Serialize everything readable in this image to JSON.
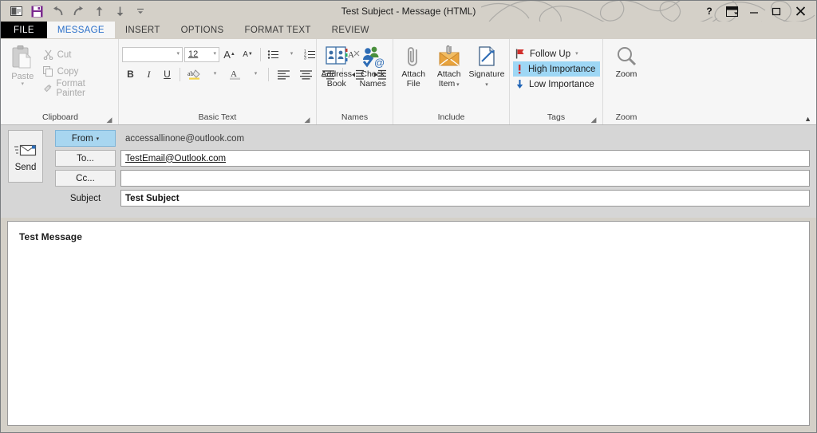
{
  "window": {
    "title": "Test Subject - Message (HTML)",
    "controls": {
      "help": "?",
      "ribbon_options": "ribbon-display-options",
      "minimize": "minimize",
      "maximize": "maximize",
      "close": "close"
    }
  },
  "quick_access": {
    "items": [
      {
        "name": "outlook-icon",
        "label": "Outlook"
      },
      {
        "name": "save-icon",
        "label": "Save"
      },
      {
        "name": "undo-icon",
        "label": "Undo"
      },
      {
        "name": "redo-icon",
        "label": "Redo"
      },
      {
        "name": "previous-item-icon",
        "label": "Previous Item"
      },
      {
        "name": "next-item-icon",
        "label": "Next Item"
      },
      {
        "name": "customize-qat-icon",
        "label": "Customize Quick Access Toolbar"
      }
    ]
  },
  "tabs": [
    {
      "label": "FILE",
      "state": "file"
    },
    {
      "label": "MESSAGE",
      "state": "active"
    },
    {
      "label": "INSERT",
      "state": "normal"
    },
    {
      "label": "OPTIONS",
      "state": "normal"
    },
    {
      "label": "FORMAT TEXT",
      "state": "normal"
    },
    {
      "label": "REVIEW",
      "state": "normal"
    }
  ],
  "ribbon": {
    "collapse_caret": "▲",
    "groups": {
      "clipboard": {
        "label": "Clipboard",
        "paste": "Paste",
        "paste_caret": "▾",
        "items": [
          "Cut",
          "Copy",
          "Format Painter"
        ]
      },
      "basic_text": {
        "label": "Basic Text",
        "font_name": "",
        "font_size": "12",
        "grow_font": "A",
        "shrink_font": "A",
        "bold": "B",
        "italic": "I",
        "underline": "U",
        "font_color": "A",
        "caret": "▾"
      },
      "names": {
        "label": "Names",
        "buttons": [
          {
            "line1": "Address",
            "line2": "Book"
          },
          {
            "line1": "Check",
            "line2": "Names"
          }
        ]
      },
      "include": {
        "label": "Include",
        "buttons": [
          {
            "line1": "Attach",
            "line2": "File",
            "caret": ""
          },
          {
            "line1": "Attach",
            "line2": "Item",
            "caret": " ▾"
          },
          {
            "line1": "Signature",
            "line2": "▾",
            "caret": ""
          }
        ]
      },
      "tags": {
        "label": "Tags",
        "items": [
          {
            "label": "Follow Up",
            "icon": "flag-icon",
            "caret": "▾",
            "selected": false
          },
          {
            "label": "High Importance",
            "icon": "exclamation-icon",
            "caret": "",
            "selected": true
          },
          {
            "label": "Low Importance",
            "icon": "down-arrow-icon",
            "caret": "",
            "selected": false
          }
        ]
      },
      "zoom": {
        "label": "Zoom",
        "button": "Zoom"
      }
    }
  },
  "compose": {
    "send_button": "Send",
    "from_button": "From",
    "from_caret": "▾",
    "from_value": "accessallinone@outlook.com",
    "to_button": "To...",
    "to_value": "TestEmail@Outlook.com",
    "cc_button": "Cc...",
    "cc_value": "",
    "subject_label": "Subject",
    "subject_value": "Test Subject",
    "body_text": "Test Message"
  },
  "colors": {
    "accent_blue": "#2a6fc9",
    "highlight": "#9ed7f5",
    "from_button": "#a8d6f0",
    "importance_red": "#cf2a27",
    "importance_blue": "#1f63b5",
    "save_purple": "#7b2a8f"
  }
}
